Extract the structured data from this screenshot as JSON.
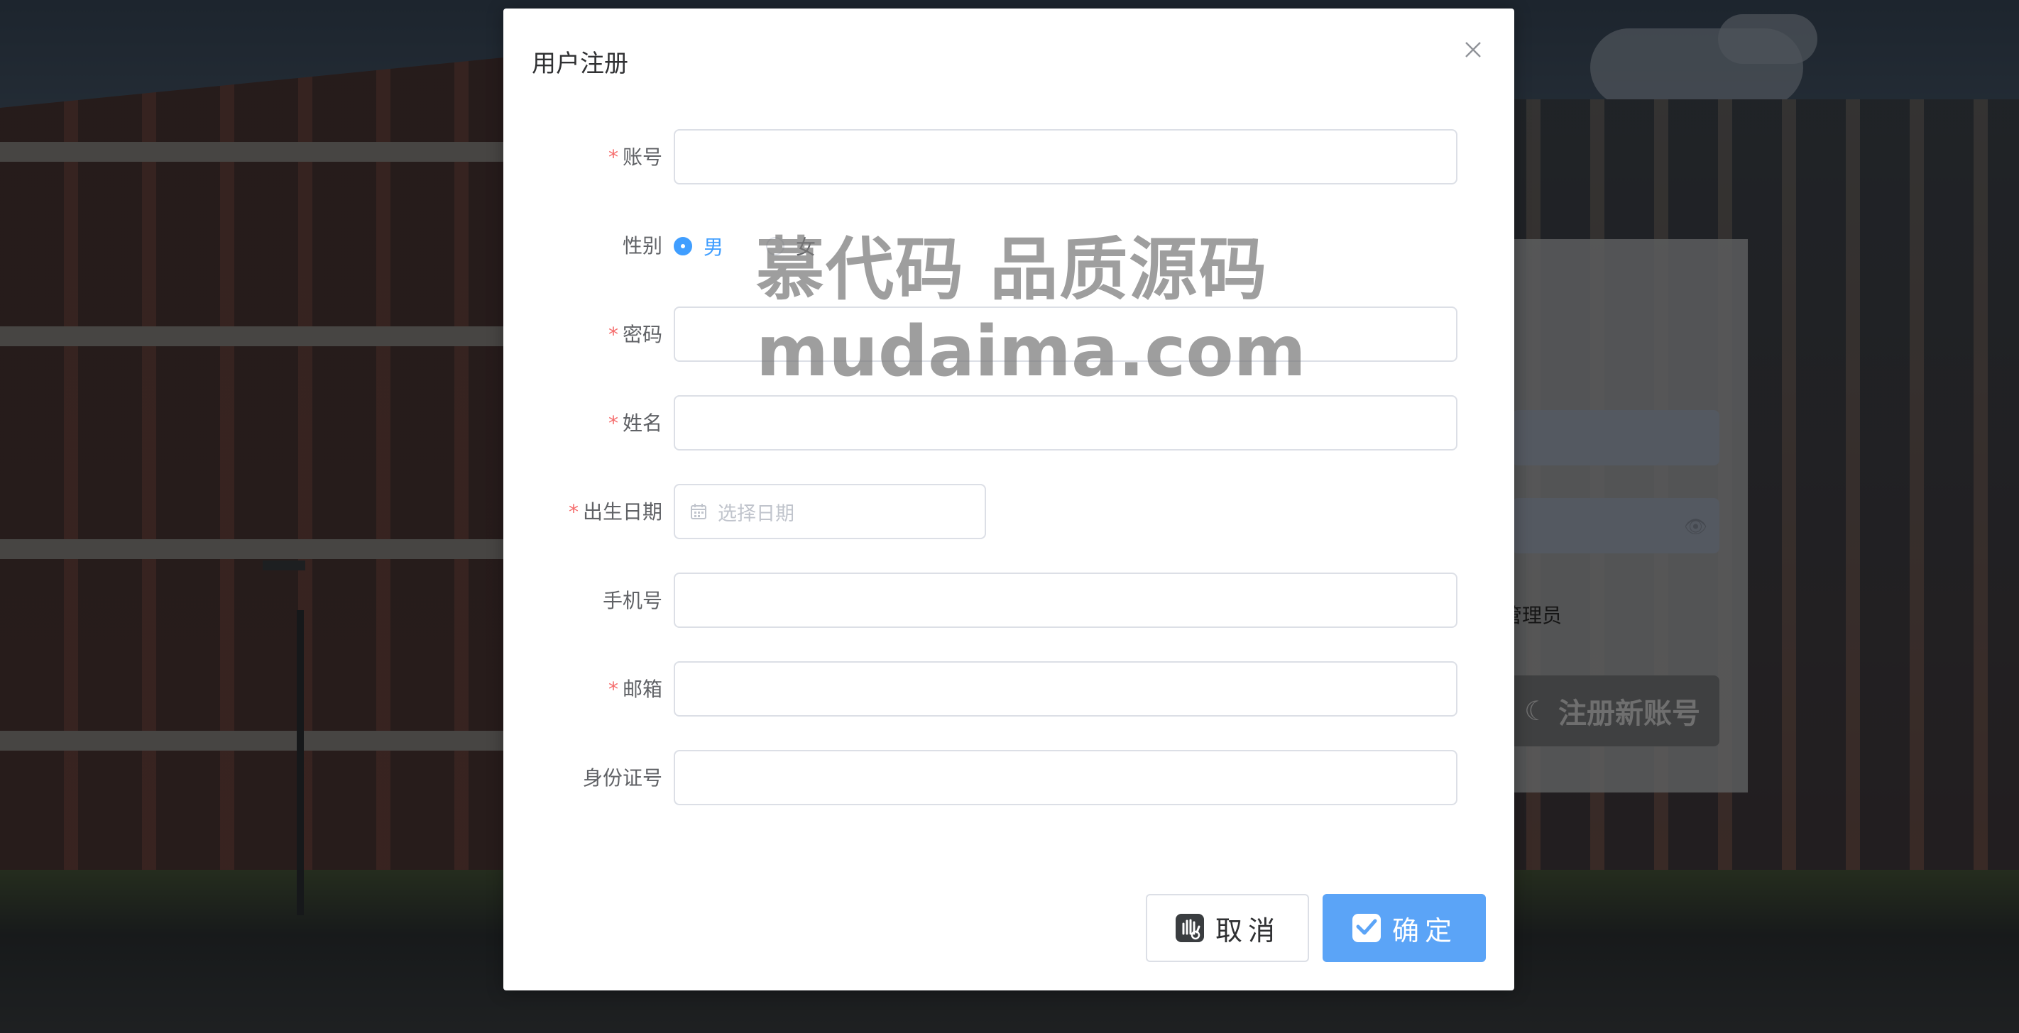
{
  "dialog": {
    "title": "用户注册",
    "close_icon": "close-icon"
  },
  "form": {
    "account": {
      "label": "账号",
      "required": true,
      "value": ""
    },
    "gender": {
      "label": "性别",
      "options": [
        "男",
        "女"
      ],
      "selected": "男"
    },
    "password": {
      "label": "密码",
      "required": true,
      "value": ""
    },
    "name": {
      "label": "姓名",
      "required": true,
      "value": ""
    },
    "birthdate": {
      "label": "出生日期",
      "required": true,
      "placeholder": "选择日期",
      "icon": "calendar-icon"
    },
    "phone": {
      "label": "手机号",
      "required": false,
      "value": ""
    },
    "email": {
      "label": "邮箱",
      "required": true,
      "value": ""
    },
    "idcard": {
      "label": "身份证号",
      "required": false,
      "value": ""
    },
    "required_mark": "*"
  },
  "buttons": {
    "cancel": "取消",
    "confirm": "确定"
  },
  "background_login": {
    "role_text": "管理员",
    "register_button": "注册新账号"
  },
  "watermark": {
    "line1": "慕代码 品质源码",
    "line2": "mudaima.com"
  },
  "colors": {
    "primary": "#409eff",
    "confirm_button": "#5ba4f7",
    "required": "#f56c6c",
    "label": "#606266",
    "border": "#dcdfe6"
  }
}
